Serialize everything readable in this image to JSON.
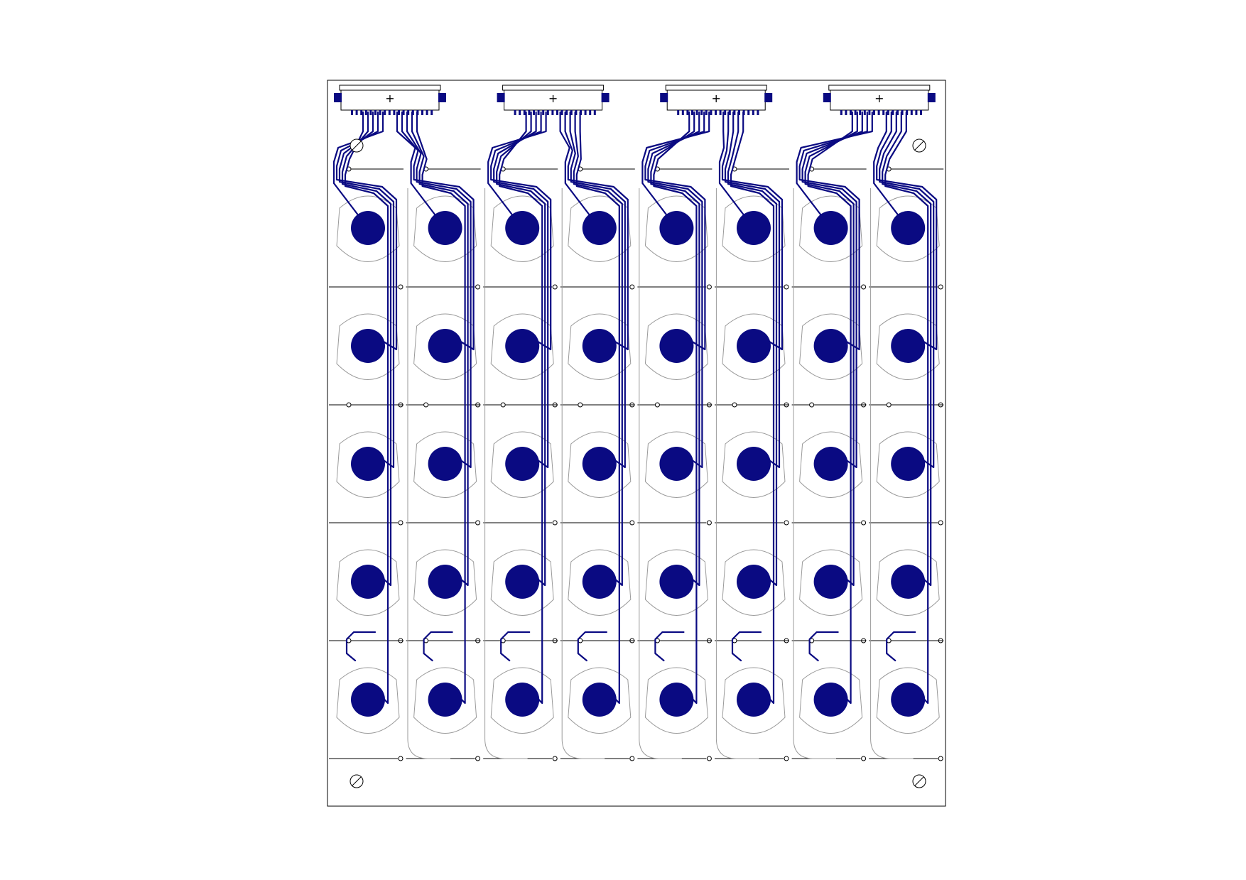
{
  "colors": {
    "pad": "#0a0a82",
    "trace": "#0a0a82",
    "outline": "#000000",
    "pad_outline": "#9a9a9a",
    "background": "#ffffff"
  },
  "board": {
    "columns": 8,
    "rows": 5,
    "connectors": 4,
    "connector_label": "+",
    "mounting_holes": 4
  }
}
